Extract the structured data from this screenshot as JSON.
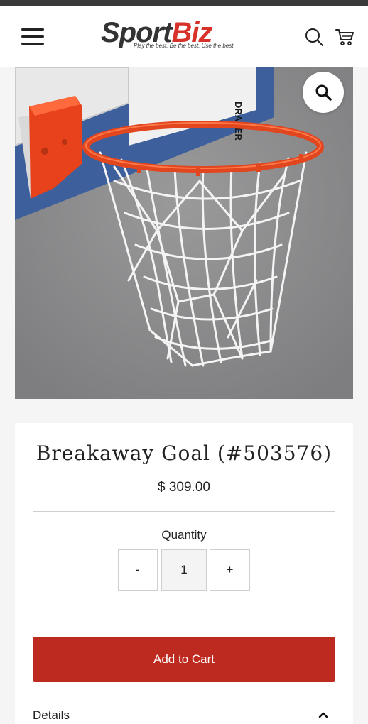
{
  "header": {
    "logo_sport": "Sport",
    "logo_biz": "Biz",
    "logo_tagline": "Play the best. Be the best. Use the best."
  },
  "product_image": {
    "backboard_text": "DRAPER"
  },
  "product": {
    "title": "Breakaway Goal (#503576)",
    "price": "$ 309.00",
    "quantity_label": "Quantity",
    "qty_minus": "-",
    "qty_value": "1",
    "qty_plus": "+",
    "add_to_cart": "Add to Cart",
    "details_label": "Details"
  },
  "colors": {
    "accent": "#bd2a20",
    "logo_red": "#d6322a",
    "rim_orange": "#e2461f"
  },
  "icons": [
    "menu-icon",
    "search-icon",
    "cart-icon",
    "zoom-icon",
    "chevron-up-icon"
  ]
}
